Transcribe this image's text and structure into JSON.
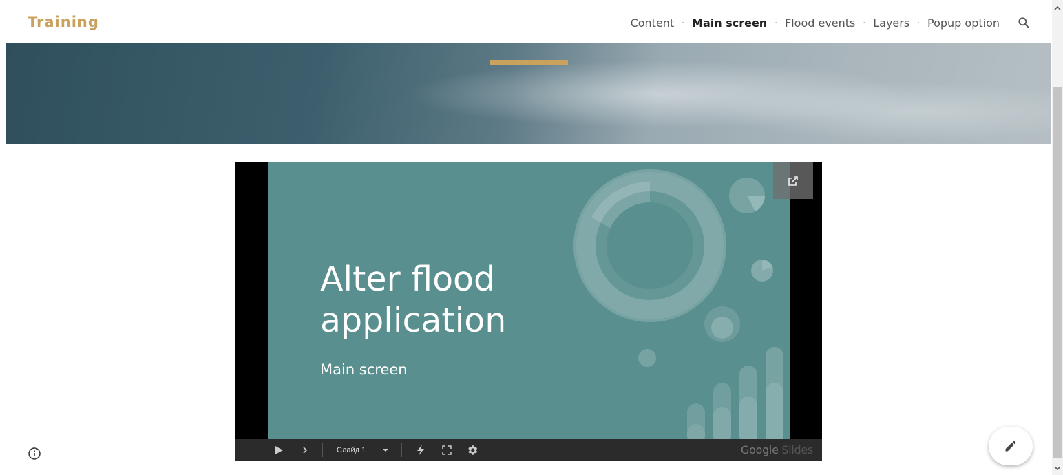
{
  "header": {
    "site_title": "Training",
    "nav": [
      {
        "label": "Content",
        "active": false
      },
      {
        "label": "Main screen",
        "active": true
      },
      {
        "label": "Flood events",
        "active": false
      },
      {
        "label": "Layers",
        "active": false
      },
      {
        "label": "Popup option",
        "active": false
      }
    ],
    "nav_separator": "·",
    "search_icon": "search-icon"
  },
  "colors": {
    "accent": "#c9a25e",
    "slide_bg": "#5a8f8f",
    "controls_bg": "#2b2b2b"
  },
  "slide": {
    "title_line1": "Alter flood",
    "title_line2": "application",
    "subtitle": "Main screen"
  },
  "controls": {
    "slide_label": "Слайд 1",
    "branding_1": "Google",
    "branding_2": " Slides"
  },
  "icons": {
    "popout": "open-in-new-icon",
    "play": "play-icon",
    "next": "chevron-right-icon",
    "dropdown": "caret-down-icon",
    "pointer": "laser-pointer-icon",
    "fullscreen": "fullscreen-icon",
    "settings": "gear-icon",
    "info": "info-icon",
    "edit": "pencil-icon"
  }
}
